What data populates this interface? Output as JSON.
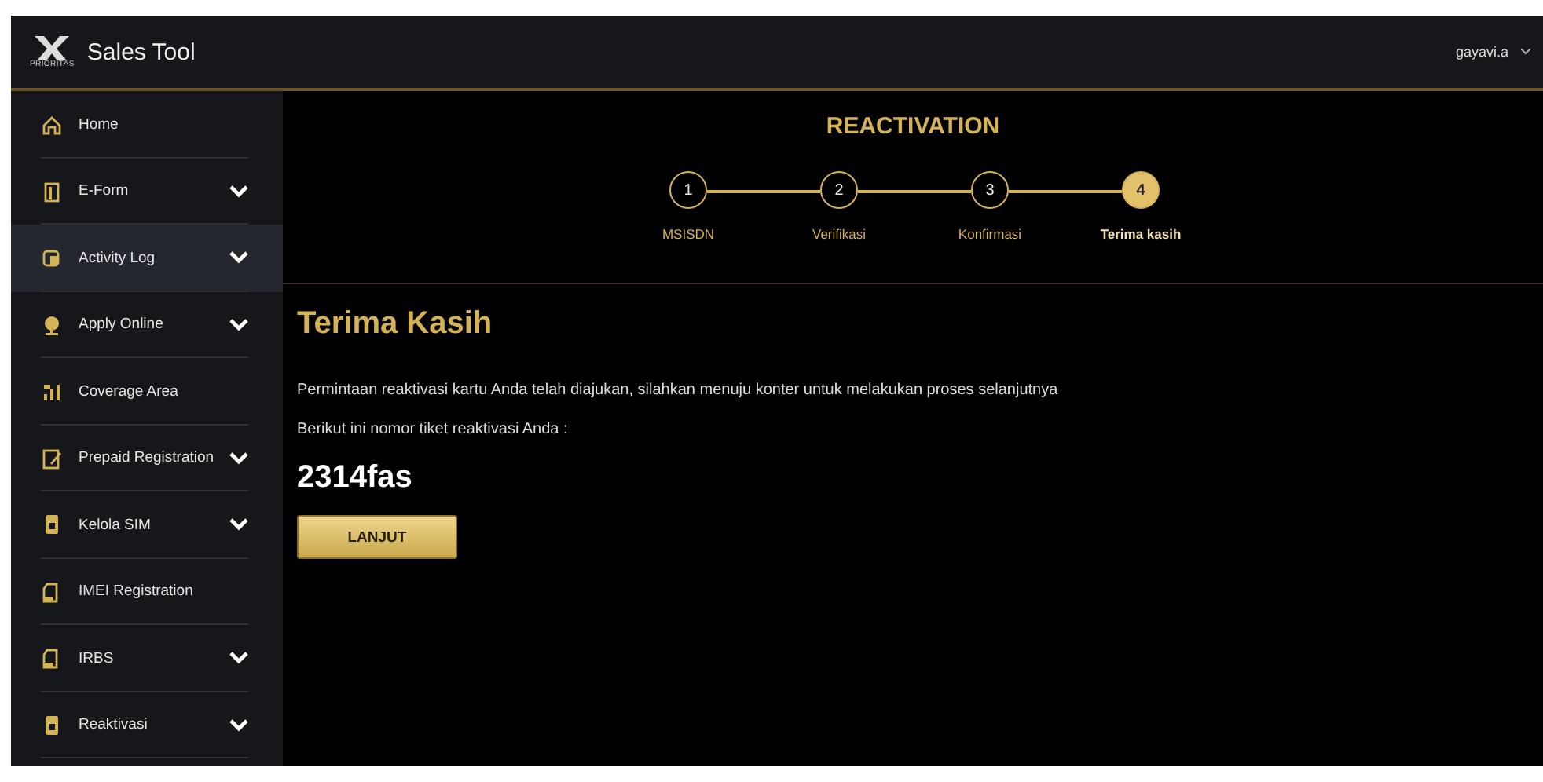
{
  "header": {
    "logo_caption": "PRIORITAS",
    "title": "Sales Tool",
    "user": "gayavi.a"
  },
  "sidebar": {
    "items": [
      {
        "label": "Home",
        "expandable": false,
        "selected": false
      },
      {
        "label": "E-Form",
        "expandable": true,
        "selected": false
      },
      {
        "label": "Activity Log",
        "expandable": true,
        "selected": true
      },
      {
        "label": "Apply Online",
        "expandable": true,
        "selected": false
      },
      {
        "label": "Coverage Area",
        "expandable": false,
        "selected": false
      },
      {
        "label": "Prepaid Registration",
        "expandable": true,
        "selected": false
      },
      {
        "label": "Kelola SIM",
        "expandable": true,
        "selected": false
      },
      {
        "label": "IMEI Registration",
        "expandable": false,
        "selected": false
      },
      {
        "label": "IRBS",
        "expandable": true,
        "selected": false
      },
      {
        "label": "Reaktivasi",
        "expandable": true,
        "selected": false
      }
    ]
  },
  "page_title": "REACTIVATION",
  "steps": [
    {
      "number": "1",
      "label": "MSISDN",
      "selected": false
    },
    {
      "number": "2",
      "label": "Verifikasi",
      "selected": false
    },
    {
      "number": "3",
      "label": "Konfirmasi",
      "selected": false
    },
    {
      "number": "4",
      "label": "Terima kasih",
      "selected": true
    }
  ],
  "result": {
    "heading": "Terima Kasih",
    "message": "Permintaan reaktivasi kartu Anda telah diajukan, silahkan menuju konter untuk melakukan proses selanjutnya",
    "ticket_label": "Berikut ini nomor tiket reaktivasi Anda :",
    "ticket_number": "2314fas",
    "button": "LANJUT"
  }
}
